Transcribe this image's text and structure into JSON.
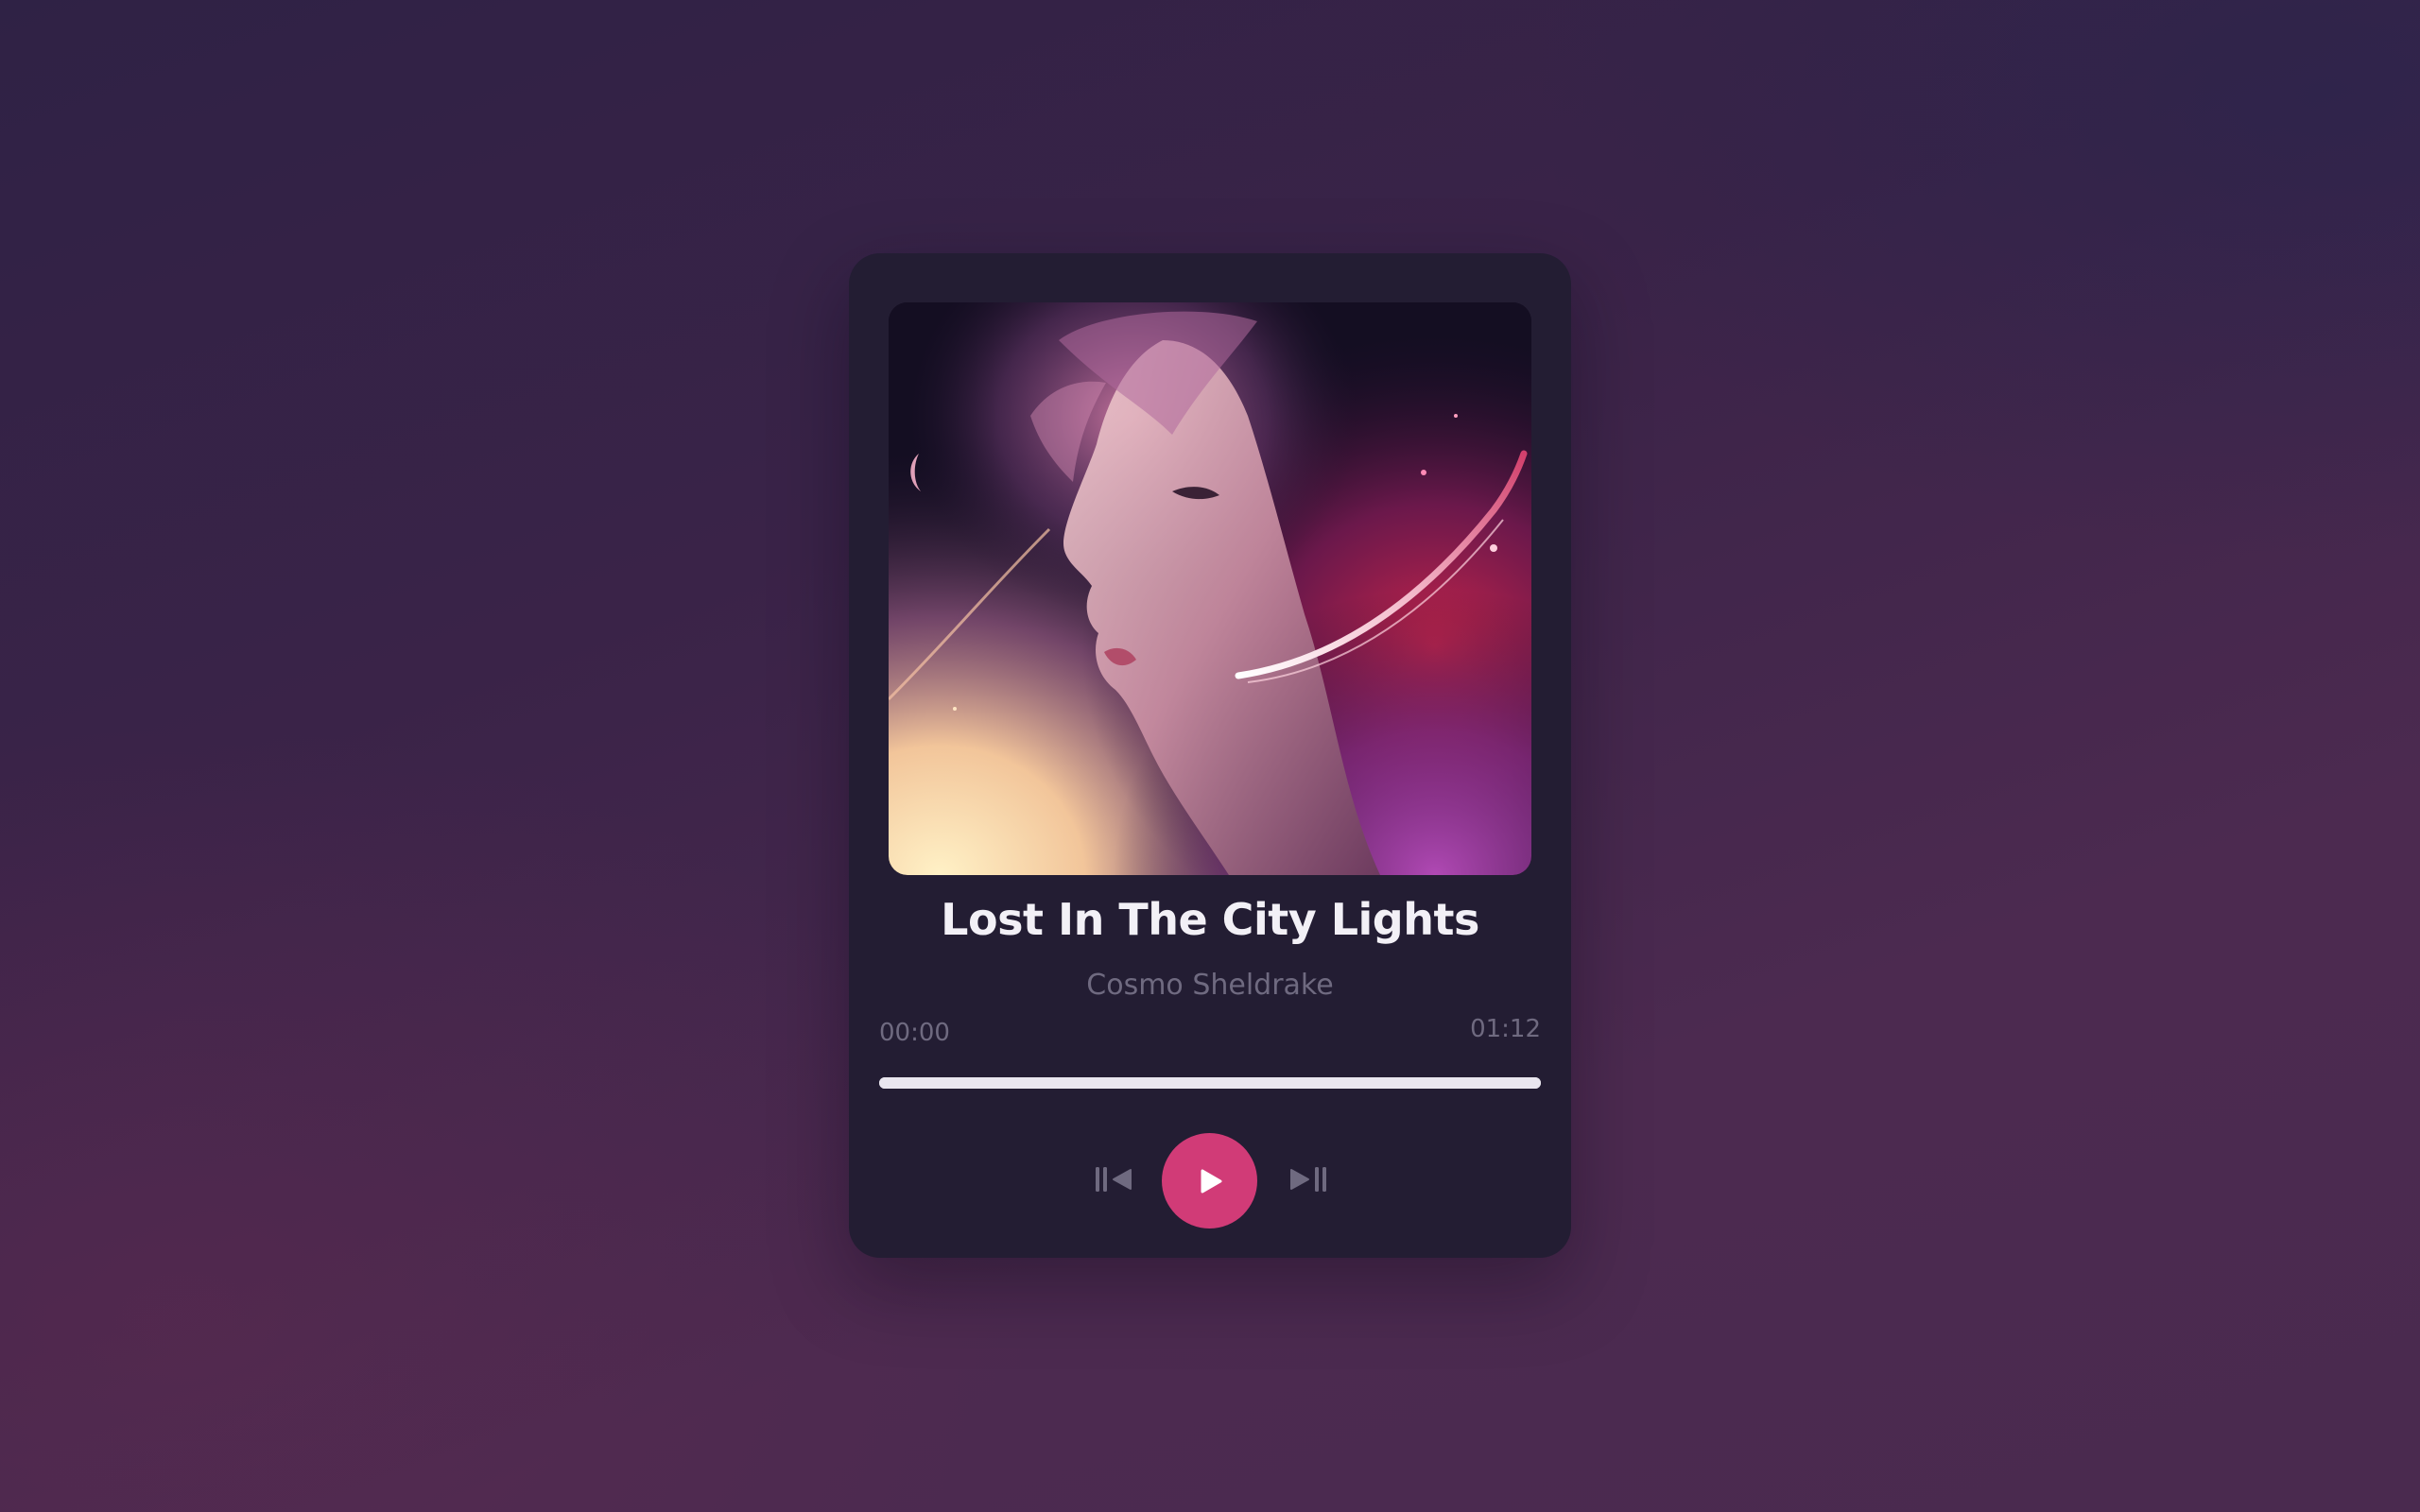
{
  "track": {
    "title": "Lost In The City Lights",
    "artist": "Cosmo Sheldrake",
    "cover_alt": "Album cover: portrait of a woman in cosmic nebula"
  },
  "playback": {
    "current_time": "00:00",
    "total_time": "01:12",
    "progress_fraction": 1.0,
    "state": "paused"
  },
  "controls": {
    "previous_icon": "skip-previous-icon",
    "play_icon": "play-icon",
    "next_icon": "skip-next-icon"
  },
  "colors": {
    "accent": "#d13b77",
    "card_background": "#231d33",
    "title_text": "#f2f0f6",
    "muted_text": "#6f6a80",
    "progress_bar": "#e9e6ef"
  }
}
